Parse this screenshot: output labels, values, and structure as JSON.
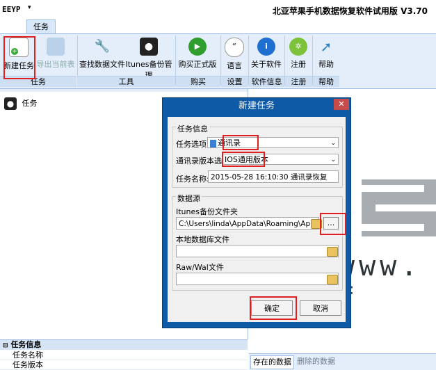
{
  "titlebar": {
    "logo": "ЕEYP",
    "quick_access_arrow": "▾",
    "title": "北亚苹果手机数据恢复软件试用版 V3.70"
  },
  "ribbon": {
    "tabs": [
      {
        "label": "任务"
      }
    ],
    "buttons": {
      "new_task": "新建任务",
      "export": "导出当前表",
      "find_data": "查找数据文件",
      "itunes_backup": "Itunes备份管理",
      "buy": "购买正式版",
      "language": "语言",
      "about": "关于软件",
      "register": "注册",
      "help": "帮助"
    },
    "groups": {
      "task": "任务",
      "tools": "工具",
      "buy": "购买",
      "settings": "设置",
      "software_info": "软件信息",
      "register": "注册",
      "help": "帮助"
    }
  },
  "tree": {
    "item_label": "任务"
  },
  "properties": {
    "header": "任务信息",
    "rows": [
      "任务名称",
      "任务版本"
    ]
  },
  "right_tabs": {
    "existing": "存在的数据",
    "deleted": "删除的数据"
  },
  "watermark": {
    "text": "www. f"
  },
  "dialog": {
    "title": "新建任务",
    "close": "✕",
    "task_info_group": "任务信息",
    "task_option_label": "任务选项:",
    "task_option_value": "通讯录",
    "contacts_version_label": "通讯录版本选",
    "contacts_version_value": "IOS通用版本",
    "task_name_label": "任务名称:",
    "task_name_value": "2015-05-28 16:10:30 通讯录恢复",
    "datasource_group": "数据源",
    "itunes_folder_label": "Itunes备份文件夹",
    "itunes_folder_value": "C:\\Users\\linda\\AppData\\Roaming\\Apple Computer",
    "browse_label": "...",
    "local_db_label": "本地数据库文件",
    "local_db_value": "",
    "raw_label": "Raw/Wal文件",
    "raw_value": "",
    "ok": "确定",
    "cancel": "取消"
  },
  "colors": {
    "ribbon_bg": "#e4eefa",
    "dialog_border": "#0e5aa7",
    "highlight": "#e02020"
  }
}
